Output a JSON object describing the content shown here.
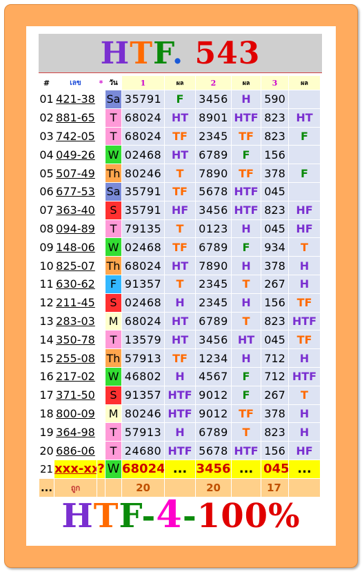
{
  "title": {
    "part1": "H",
    "part2": "T",
    "part3": "F",
    "dot": ".",
    "number": "543"
  },
  "headers": {
    "num": "#",
    "code": "เลข",
    "star": "*",
    "day": "วัน",
    "c1": "1",
    "r1": "ผล",
    "c2": "2",
    "r2": "ผล",
    "c3": "3",
    "r3": "ผล"
  },
  "rows": [
    {
      "n": "01",
      "code": "421-38",
      "day": "Sa",
      "v1": "35791",
      "h1": "F",
      "v2": "3456",
      "h2": "H",
      "v3": "590",
      "h3": ""
    },
    {
      "n": "02",
      "code": "881-65",
      "day": "T",
      "v1": "68024",
      "h1": "HT",
      "v2": "8901",
      "h2": "HTF",
      "v3": "823",
      "h3": "HT"
    },
    {
      "n": "03",
      "code": "742-05",
      "day": "T",
      "v1": "68024",
      "h1": "TF",
      "v2": "2345",
      "h2": "TF",
      "v3": "823",
      "h3": "F"
    },
    {
      "n": "04",
      "code": "049-26",
      "day": "W",
      "v1": "02468",
      "h1": "HT",
      "v2": "6789",
      "h2": "F",
      "v3": "156",
      "h3": ""
    },
    {
      "n": "05",
      "code": "507-49",
      "day": "Th",
      "v1": "80246",
      "h1": "T",
      "v2": "7890",
      "h2": "TF",
      "v3": "378",
      "h3": "F"
    },
    {
      "n": "06",
      "code": "677-53",
      "day": "Sa",
      "v1": "35791",
      "h1": "TF",
      "v2": "5678",
      "h2": "HTF",
      "v3": "045",
      "h3": ""
    },
    {
      "n": "07",
      "code": "363-40",
      "day": "S",
      "v1": "35791",
      "h1": "HF",
      "v2": "3456",
      "h2": "HTF",
      "v3": "823",
      "h3": "HF"
    },
    {
      "n": "08",
      "code": "094-89",
      "day": "T",
      "v1": "79135",
      "h1": "T",
      "v2": "0123",
      "h2": "H",
      "v3": "045",
      "h3": "HF"
    },
    {
      "n": "09",
      "code": "148-06",
      "day": "W",
      "v1": "02468",
      "h1": "TF",
      "v2": "6789",
      "h2": "F",
      "v3": "934",
      "h3": "T"
    },
    {
      "n": "10",
      "code": "825-07",
      "day": "Th",
      "v1": "68024",
      "h1": "HT",
      "v2": "7890",
      "h2": "H",
      "v3": "378",
      "h3": "H"
    },
    {
      "n": "11",
      "code": "630-62",
      "day": "F",
      "v1": "91357",
      "h1": "T",
      "v2": "2345",
      "h2": "T",
      "v3": "267",
      "h3": "H"
    },
    {
      "n": "12",
      "code": "211-45",
      "day": "S",
      "v1": "02468",
      "h1": "H",
      "v2": "2345",
      "h2": "H",
      "v3": "156",
      "h3": "TF"
    },
    {
      "n": "13",
      "code": "283-03",
      "day": "M",
      "v1": "68024",
      "h1": "HT",
      "v2": "6789",
      "h2": "T",
      "v3": "823",
      "h3": "HTF"
    },
    {
      "n": "14",
      "code": "350-78",
      "day": "T",
      "v1": "13579",
      "h1": "HT",
      "v2": "3456",
      "h2": "HT",
      "v3": "045",
      "h3": "TF"
    },
    {
      "n": "15",
      "code": "255-08",
      "day": "Th",
      "v1": "57913",
      "h1": "TF",
      "v2": "1234",
      "h2": "H",
      "v3": "712",
      "h3": "H"
    },
    {
      "n": "16",
      "code": "217-02",
      "day": "W",
      "v1": "46802",
      "h1": "H",
      "v2": "4567",
      "h2": "F",
      "v3": "712",
      "h3": "HTF"
    },
    {
      "n": "17",
      "code": "371-50",
      "day": "S",
      "v1": "91357",
      "h1": "HTF",
      "v2": "9012",
      "h2": "F",
      "v3": "267",
      "h3": "T"
    },
    {
      "n": "18",
      "code": "800-09",
      "day": "M",
      "v1": "80246",
      "h1": "HTF",
      "v2": "9012",
      "h2": "TF",
      "v3": "378",
      "h3": "H"
    },
    {
      "n": "19",
      "code": "364-98",
      "day": "T",
      "v1": "57913",
      "h1": "H",
      "v2": "6789",
      "h2": "T",
      "v3": "823",
      "h3": "H"
    },
    {
      "n": "20",
      "code": "686-06",
      "day": "T",
      "v1": "24680",
      "h1": "HTF",
      "v2": "5678",
      "h2": "HTF",
      "v3": "156",
      "h3": "HF"
    }
  ],
  "prediction": {
    "n": "21",
    "code": "xxx-xx",
    "star": "?",
    "day": "W",
    "v1": "68024",
    "h1": "...",
    "v2": "3456",
    "h2": "...",
    "v3": "045",
    "h3": "..."
  },
  "hits": {
    "n": "...",
    "label": "ถูก",
    "c1": "20",
    "c2": "20",
    "c3": "17"
  },
  "footer": {
    "a": "H",
    "b": "T",
    "c": "F",
    "d1": "-",
    "e": "4",
    "d2": "-",
    "f": "100%"
  },
  "colors": {
    "H": "#7a2fd0",
    "T": "#ff6a00",
    "F": "#0a8a0a",
    "dayS": "#ff3030",
    "daySa": "#7a8ad8",
    "dayT": "#ff9ad8",
    "dayW": "#33dd33",
    "dayTh": "#ffa64d",
    "dayF": "#33b8ff",
    "dayM": "#ffffcc",
    "title_number": "#e00000",
    "title_dot": "#1a5ad8",
    "footer_4": "#ff00cc",
    "footer_pct": "#e00000"
  }
}
